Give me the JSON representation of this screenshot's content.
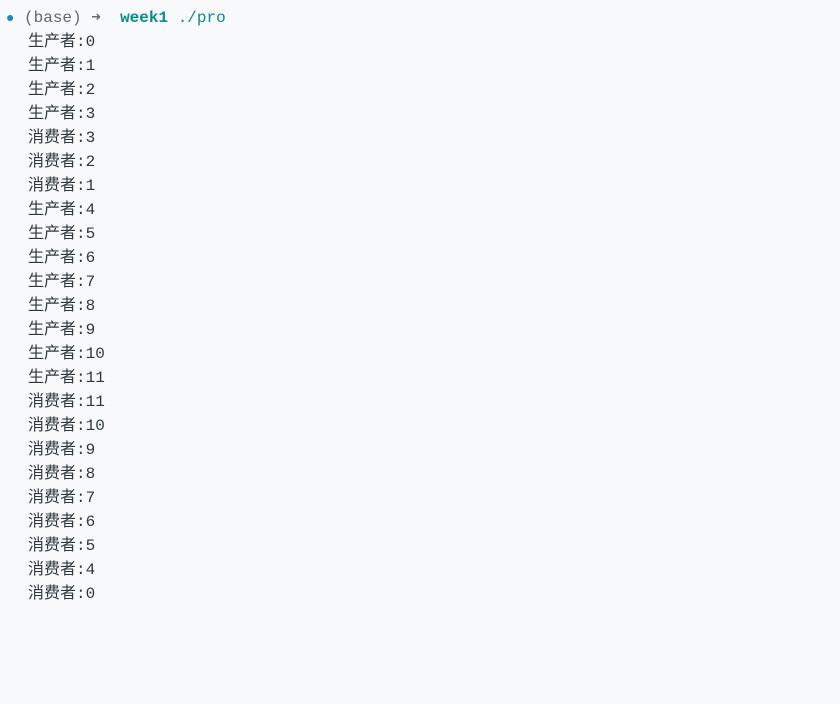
{
  "prompt": {
    "bullet": "●",
    "env": "(base)",
    "arrow": "➜",
    "dir": "week1",
    "command_prefix": "./",
    "command": "pro"
  },
  "output_lines": [
    "生产者:0",
    "生产者:1",
    "生产者:2",
    "生产者:3",
    "消费者:3",
    "消费者:2",
    "消费者:1",
    "生产者:4",
    "生产者:5",
    "生产者:6",
    "生产者:7",
    "生产者:8",
    "生产者:9",
    "生产者:10",
    "生产者:11",
    "消费者:11",
    "消费者:10",
    "消费者:9",
    "消费者:8",
    "消费者:7",
    "消费者:6",
    "消费者:5",
    "消费者:4",
    "消费者:0"
  ]
}
